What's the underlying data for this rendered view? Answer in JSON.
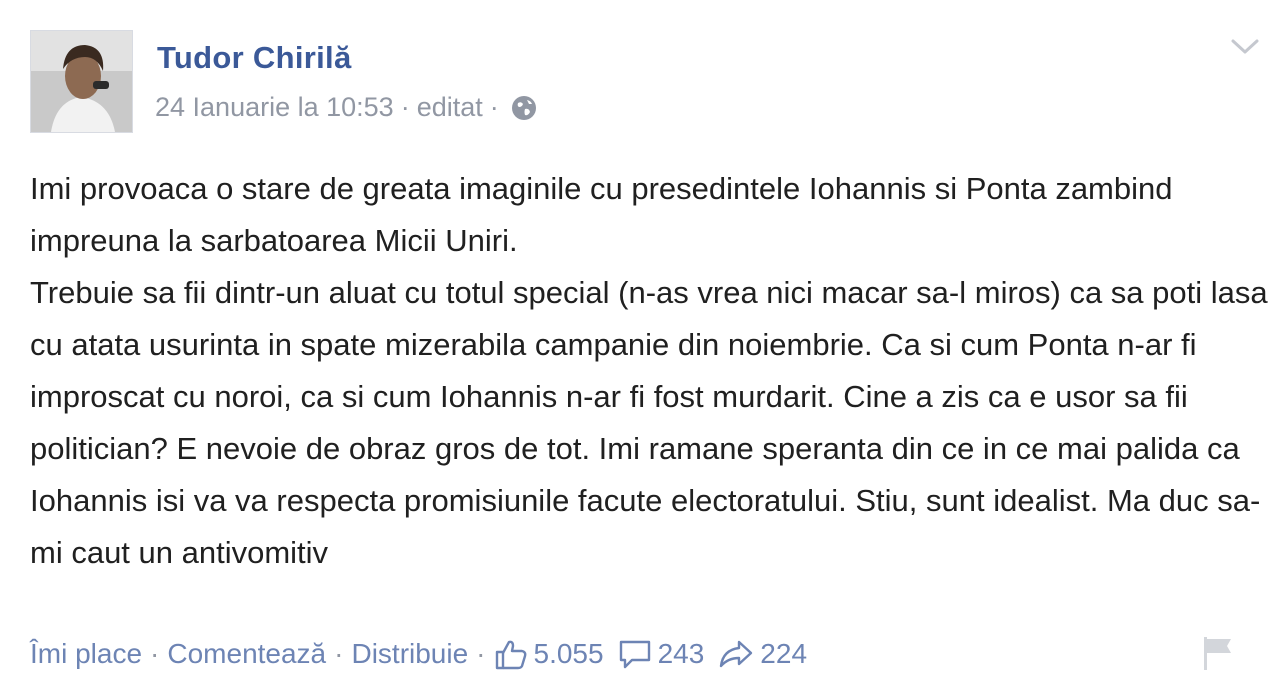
{
  "post": {
    "author": "Tudor Chirilă",
    "date": "24 Ianuarie la 10:53",
    "edited": "editat",
    "paragraphs": [
      "Imi provoaca o stare de greata imaginile cu presedintele Iohannis si Ponta zambind impreuna la sarbatoarea Micii Uniri.",
      "Trebuie sa fii dintr-un aluat cu totul special (n-as vrea nici macar sa-l miros) ca sa poti lasa cu atata usurinta in spate mizerabila campanie din noiembrie. Ca si cum Ponta n-ar fi improscat cu noroi, ca si cum Iohannis n-ar fi fost murdarit. Cine a zis ca e usor sa fii politician? E nevoie de obraz gros de tot. Imi ramane speranta din ce in ce mai palida ca Iohannis isi va va respecta promisiunile facute electoratului. Stiu, sunt idealist. Ma duc sa-mi caut un antivomitiv"
    ]
  },
  "actions": {
    "like": "Îmi place",
    "comment": "Comentează",
    "share": "Distribuie",
    "separator": "·"
  },
  "stats": {
    "likes": "5.055",
    "comments": "243",
    "shares": "224"
  },
  "icons": {
    "privacy": "globe-icon",
    "menu": "chevron-down-icon",
    "likes": "thumbs-up-icon",
    "comments": "comment-bubble-icon",
    "shares": "share-arrow-icon",
    "report": "flag-icon"
  },
  "colors": {
    "author": "#3b5998",
    "link": "#6d84b4",
    "meta": "#9197a3",
    "text": "#202020"
  }
}
